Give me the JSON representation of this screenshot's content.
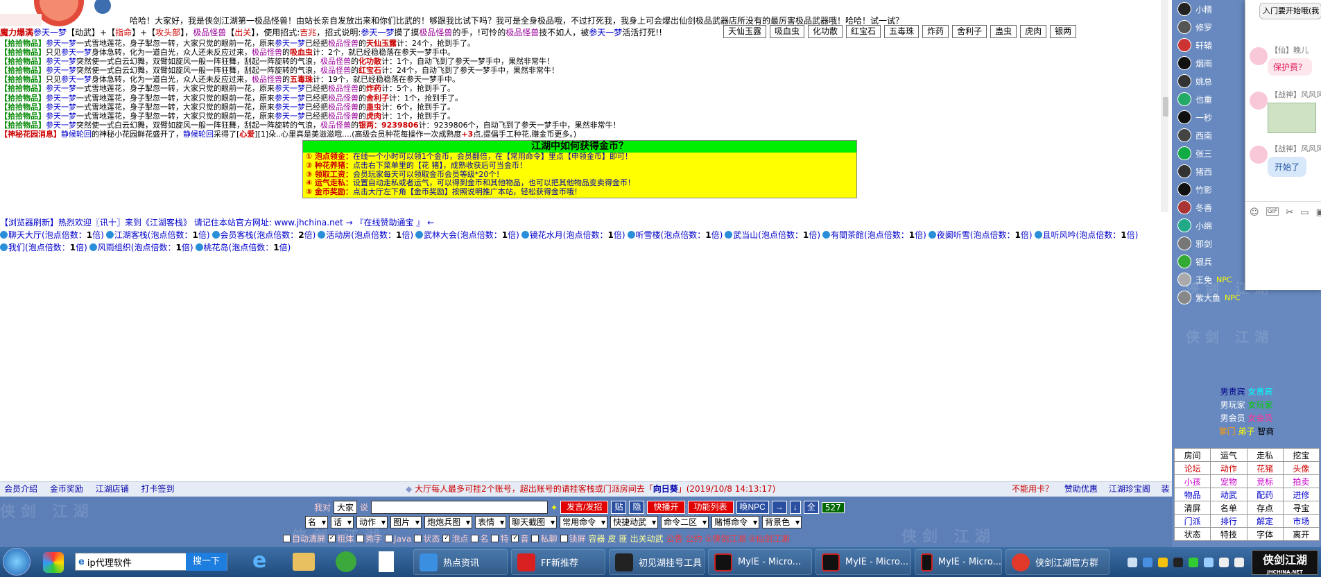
{
  "intro": {
    "text": "哈哈！大家好，我是侠剑江湖第一极品怪兽！由站长亲自发放出来和你们比武的！够跟我比试下吗？我可是全身极品哦，不过打死我，我身上可会爆出仙剑极品武器店所没有的最厉害极品武器哦！哈哈！试一试？"
  },
  "status_line": {
    "p1": "魔力爆满",
    "p2": "参天一梦",
    "p3": "【动武】+【",
    "p4": "指命",
    "p5": "】+【",
    "p6": "攻头部",
    "p7": "】，",
    "p8": "极品怪兽",
    "p9": "【",
    "p10": "出关",
    "p11": "】，使用招式:",
    "p12": "吉兆",
    "p13": "，招式说明:",
    "p14": "参天一梦",
    "p15": "摸了摸",
    "p16": "极品怪兽",
    "p17": "的手，!可怜的",
    "p18": "极品怪兽",
    "p19": "技不如人，被",
    "p20": "参天一梦",
    "p21": "活活打死!!"
  },
  "item_buttons": [
    "天仙玉露",
    "吸血虫",
    "化功散",
    "红宝石",
    "五毒珠",
    "炸药",
    "舍利子",
    "蛊虫",
    "虎肉",
    "银两"
  ],
  "messages": [
    {
      "tag": "【拾拾物品】",
      "a": "参天一梦",
      "b": "一式雪地莲花，身子掣忽一转，大家只觉的眼前一花，原来",
      "c": "参天一梦",
      "d": "已经把",
      "e": "极品怪兽",
      "f": "的",
      "g": "天仙玉露",
      "h": "计：24个，抢到手了。"
    },
    {
      "tag": "【拾拾物品】",
      "a": "只见",
      "b": "参天一梦",
      "c": "身体急转，化为一道白光，众人还未反应过来，",
      "d": "极品怪兽",
      "e": "的",
      "g": "吸血虫",
      "h": "计：2个，就已经稳稳落在参天一梦手中。"
    },
    {
      "tag": "【拾拾物品】",
      "a": "参天一梦",
      "b": "突然使一式白云幻舞，双臂如旋风一般一阵狂舞，刮起一阵旋转的气浪，",
      "d": "极品怪兽",
      "e": "的",
      "g": "化功散",
      "h": "计：1个，自动飞到了参天一梦手中，果然非常牛！"
    },
    {
      "tag": "【拾拾物品】",
      "a": "参天一梦",
      "b": "突然使一式白云幻舞，双臂如旋风一般一阵狂舞，刮起一阵旋转的气浪，",
      "d": "极品怪兽",
      "e": "的",
      "g": "红宝石",
      "h": "计：24个，自动飞到了参天一梦手中，果然非常牛！"
    },
    {
      "tag": "【拾拾物品】",
      "a": "只见",
      "b": "参天一梦",
      "c": "身体急转，化为一道白光，众人还未反应过来，",
      "d": "极品怪兽",
      "e": "的",
      "g": "五毒珠",
      "h": "计：19个，就已经稳稳落在参天一梦手中。"
    },
    {
      "tag": "【拾拾物品】",
      "a": "参天一梦",
      "b": "一式雪地莲花，身子掣忽一转，大家只觉的眼前一花，原来",
      "c": "参天一梦",
      "d": "已经把",
      "e": "极品怪兽",
      "f": "的",
      "g": "炸药",
      "h": "计：5个，抢到手了。"
    },
    {
      "tag": "【拾拾物品】",
      "a": "参天一梦",
      "b": "一式雪地莲花，身子掣忽一转，大家只觉的眼前一花，原来",
      "c": "参天一梦",
      "d": "已经把",
      "e": "极品怪兽",
      "f": "的",
      "g": "舍利子",
      "h": "计：1个，抢到手了。"
    },
    {
      "tag": "【拾拾物品】",
      "a": "参天一梦",
      "b": "一式雪地莲花，身子掣忽一转，大家只觉的眼前一花，原来",
      "c": "参天一梦",
      "d": "已经把",
      "e": "极品怪兽",
      "f": "的",
      "g": "蛊虫",
      "h": "计：6个，抢到手了。"
    },
    {
      "tag": "【拾拾物品】",
      "a": "参天一梦",
      "b": "一式雪地莲花，身子掣忽一转，大家只觉的眼前一花，原来",
      "c": "参天一梦",
      "d": "已经把",
      "e": "极品怪兽",
      "f": "的",
      "g": "虎肉",
      "h": "计：1个，抢到手了。"
    },
    {
      "tag": "【拾拾物品】",
      "a": "参天一梦",
      "b": "突然使一式白云幻舞，双臂如旋风一般一阵狂舞，刮起一阵旋转的气浪，",
      "d": "极品怪兽",
      "e": "的",
      "g": "银两：9239806",
      "h": "计：9239806个，自动飞到了参天一梦手中，果然非常牛！"
    }
  ],
  "garden": {
    "tag": "【神秘花园消息】",
    "a": "静候轮回",
    "b": "的神秘小花园鲜花盛开了，",
    "c": "静候轮回",
    "d": "采得了[",
    "e": "心爱",
    "f": "][1]朵..心里真是美滋滋哦....(高级会员种花每操作一次成熟度",
    "g": "+3",
    "h": "点,提倡手工种花,赚金币更多。)"
  },
  "notice": {
    "title": "江湖中如何获得金币？",
    "lines": [
      {
        "n": "①",
        "k": "泡点领金：",
        "v": "在线一个小时可以领1个金币，会员翻倍，在【常用命令】里点【申领金币】即可！"
      },
      {
        "n": "②",
        "k": "种花养猪：",
        "v": "点击右下菜单里的【花 猪】，成熟收获后可当金币！"
      },
      {
        "n": "③",
        "k": "领取工资：",
        "v": "会员玩家每天可以领取金币会员等级*20个！"
      },
      {
        "n": "④",
        "k": "运气走私：",
        "v": "设置自动走私或者运气，可以得到金币和其他物品，也可以把其他物品变卖得金币！"
      },
      {
        "n": "⑤",
        "k": "金币奖励：",
        "v": "点击大厅左下角【金币奖励】按照说明推广本站，轻松获得金币哦！"
      }
    ]
  },
  "browser_line": "【浏览器刷新】热烈欢迎〖讯十〗来到《江湖客栈》 请记住本站官方网址: www.jhchina.net → 『在线赞助通宝 』 ←",
  "rooms": [
    {
      "name": "聊天大厅",
      "label": "(泡点倍数：",
      "mult": "1",
      "suffix": "倍)"
    },
    {
      "name": "江湖客栈",
      "label": "(泡点倍数：",
      "mult": "1",
      "suffix": "倍)"
    },
    {
      "name": "会员客栈",
      "label": "(泡点倍数：",
      "mult": "2",
      "suffix": "倍)"
    },
    {
      "name": "活动房",
      "label": "(泡点倍数：",
      "mult": "1",
      "suffix": "倍)"
    },
    {
      "name": "武林大会",
      "label": "(泡点倍数：",
      "mult": "1",
      "suffix": "倍)"
    },
    {
      "name": "镜花水月",
      "label": "(泡点倍数：",
      "mult": "1",
      "suffix": "倍)"
    },
    {
      "name": "听雪楼",
      "label": "(泡点倍数：",
      "mult": "1",
      "suffix": "倍)"
    },
    {
      "name": "武当山",
      "label": "(泡点倍数：",
      "mult": "1",
      "suffix": "倍)"
    },
    {
      "name": "有間茶館",
      "label": "(泡点倍数：",
      "mult": "1",
      "suffix": "倍)"
    },
    {
      "name": "夜阑听雪",
      "label": "(泡点倍数：",
      "mult": "1",
      "suffix": "倍)"
    },
    {
      "name": "且听风吟",
      "label": "(泡点倍数：",
      "mult": "1",
      "suffix": "倍)"
    },
    {
      "name": "我们",
      "label": "(泡点倍数：",
      "mult": "1",
      "suffix": "倍)"
    },
    {
      "name": "风雨组织",
      "label": "(泡点倍数：",
      "mult": "1",
      "suffix": "倍)"
    },
    {
      "name": "桃花岛",
      "label": "(泡点倍数：",
      "mult": "1",
      "suffix": "倍)"
    }
  ],
  "infobar": {
    "left": [
      "会员介绍",
      "金币奖励",
      "江湖店铺",
      "打卡签到"
    ],
    "center_pre": "大厅每人最多可挂2个账号，超出账号的请挂客栈或门派房间去「",
    "center_room": "向日葵",
    "center_post": "」(2019/10/8 14:13:17)",
    "right": [
      "不能用卡？",
      "赞助优惠",
      "江湖珍宝阁",
      "装 备"
    ]
  },
  "controls": {
    "say_label1": "我对",
    "say_target": "大家",
    "say_label2": "说",
    "send": "发言/发招",
    "paste": "贴",
    "hide": "隐",
    "fast": "快播开",
    "func": "功能列表",
    "npc": "唤NPC",
    "arrow_r": "→",
    "arrow_d": "↓",
    "full": "全",
    "count": "527",
    "selects": [
      "名",
      "话",
      "动作",
      "图片",
      "炮炮兵图",
      "表情",
      "聊天截图",
      "常用命令",
      "快捷动武",
      "命令二区",
      "赌博命令",
      "背景色"
    ],
    "checks": [
      {
        "label": "自动清屏",
        "on": false
      },
      {
        "label": "粗体",
        "on": true
      },
      {
        "label": "秀字",
        "on": false
      },
      {
        "label": "Java",
        "on": false
      },
      {
        "label": "状态",
        "on": false
      },
      {
        "label": "泡点",
        "on": true
      },
      {
        "label": "名",
        "on": false
      },
      {
        "label": "特",
        "on": false
      },
      {
        "label": "音",
        "on": true
      },
      {
        "label": "私聊",
        "on": false
      },
      {
        "label": "锁屏",
        "on": false
      }
    ],
    "links": [
      "容器",
      "皮",
      "匪",
      "出关动武",
      "公告",
      "公约",
      "①侠剑江湖",
      "②仙剑江湖"
    ],
    "watermark": "侠剑 江湖"
  },
  "users": [
    {
      "name": "小精",
      "npc": ""
    },
    {
      "name": "修罗",
      "npc": ""
    },
    {
      "name": "轩辕",
      "npc": ""
    },
    {
      "name": "烟雨",
      "npc": ""
    },
    {
      "name": "姚总",
      "npc": ""
    },
    {
      "name": "也重",
      "npc": ""
    },
    {
      "name": "一秒",
      "npc": ""
    },
    {
      "name": "西南",
      "npc": ""
    },
    {
      "name": "张三",
      "npc": ""
    },
    {
      "name": "猪西",
      "npc": ""
    },
    {
      "name": "竹影",
      "npc": ""
    },
    {
      "name": "冬香",
      "npc": ""
    },
    {
      "name": "小绵",
      "npc": ""
    },
    {
      "name": "邪剑",
      "npc": ""
    },
    {
      "name": "银兵",
      "npc": ""
    },
    {
      "name": "王免",
      "npc": "NPC"
    },
    {
      "name": "紫大鱼",
      "npc": "NPC"
    }
  ],
  "legend": {
    "r1a": "男贵宾",
    "r1b": "女贵宾",
    "r2a": "男玩家",
    "r2b": "女玩家",
    "r3a": "男会员",
    "r3b": "女会员",
    "r4a": "掌门",
    "r4b": "弟子",
    "r4c": "智商"
  },
  "grid": [
    [
      "房间",
      "运气",
      "走私",
      "挖宝"
    ],
    [
      "论坛",
      "动作",
      "花猪",
      "头像"
    ],
    [
      "小孩",
      "宠物",
      "竞标",
      "拍卖"
    ],
    [
      "物品",
      "动武",
      "配药",
      "进修"
    ],
    [
      "清屏",
      "名单",
      "存点",
      "寻宝"
    ],
    [
      "门派",
      "排行",
      "解定",
      "市场"
    ],
    [
      "状态",
      "特技",
      "字体",
      "离开"
    ]
  ],
  "popup": [
    {
      "name": "",
      "text": "入门要开始哦(我"
    },
    {
      "name": "【仙】晚儿",
      "text": "保护费？"
    },
    {
      "name": "【战神】风风风",
      "text": ""
    },
    {
      "name": "【战神】风风风",
      "text": "开始了"
    }
  ],
  "taskbar": {
    "search_text": "ip代理软件",
    "search_btn": "搜一下",
    "items": [
      "热点资讯",
      "FF新推荐",
      "初见湖挂号工具",
      "MyIE - Micro...",
      "MyIE - Micro...",
      "MyIE - Micro...",
      "侠剑江湖官方群"
    ],
    "logo": "侠剑江湖",
    "logo_sub": "JHCHINA.NET"
  },
  "colors": {
    "notice_bg": "#ffff00",
    "notice_title": "#00ee00",
    "panel": "#6789bf",
    "ctrl": "#5c7fb8",
    "taskbar": "#1f4a7c"
  }
}
